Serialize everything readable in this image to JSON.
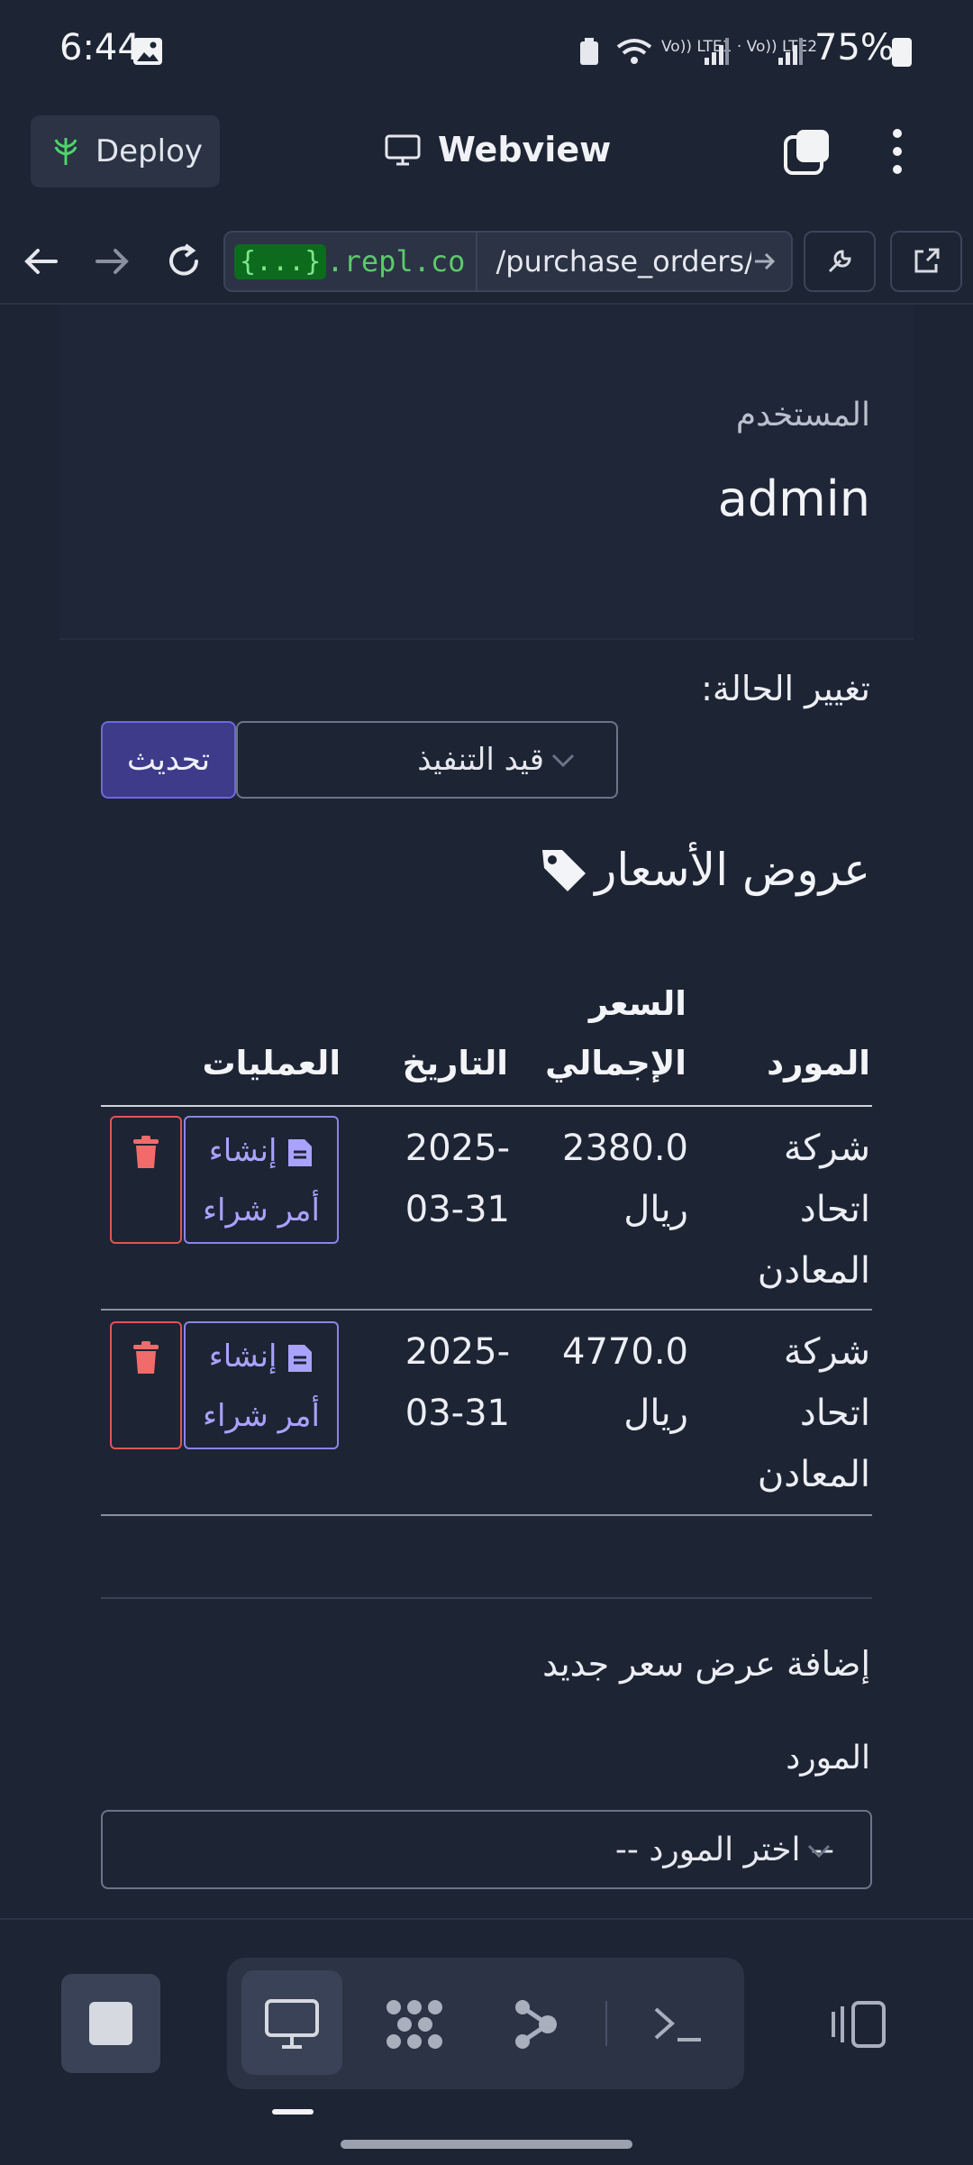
{
  "status_bar": {
    "time": "6:44",
    "network": "Vo)) LTE1 · Vo)) LTE2",
    "battery": "75%"
  },
  "app_header": {
    "deploy_label": "Deploy",
    "title": "Webview"
  },
  "url_bar": {
    "host_badge": "{...}",
    "host_rest": ".repl.co",
    "path": "/purchase_orders/reque"
  },
  "user_card": {
    "label": "المستخدم",
    "value": "admin"
  },
  "status_change": {
    "label": "تغيير الحالة:",
    "selected": "قيد التنفيذ",
    "update_button": "تحديث"
  },
  "offers": {
    "title": "عروض الأسعار",
    "headers": {
      "supplier": "المورد",
      "total_line1": "السعر",
      "total_line2": "الإجمالي",
      "date": "التاريخ",
      "actions": "العمليات"
    },
    "rows": [
      {
        "supplier": [
          "شركة",
          "اتحاد",
          "المعادن"
        ],
        "total": "2380.0",
        "currency": "ريال",
        "date_line1": "2025-",
        "date_line2": "03-31",
        "create_line1": "إنشاء",
        "create_line2": "أمر شراء"
      },
      {
        "supplier": [
          "شركة",
          "اتحاد",
          "المعادن"
        ],
        "total": "4770.0",
        "currency": "ريال",
        "date_line1": "2025-",
        "date_line2": "03-31",
        "create_line1": "إنشاء",
        "create_line2": "أمر شراء"
      }
    ]
  },
  "add_offer": {
    "title": "إضافة عرض سعر جديد",
    "supplier_label": "المورد",
    "supplier_placeholder": "-- اختر المورد --"
  },
  "colors": {
    "background": "#1d2434",
    "accent": "#6d69e0",
    "danger": "#e05555",
    "link_green": "#5cc96a"
  }
}
